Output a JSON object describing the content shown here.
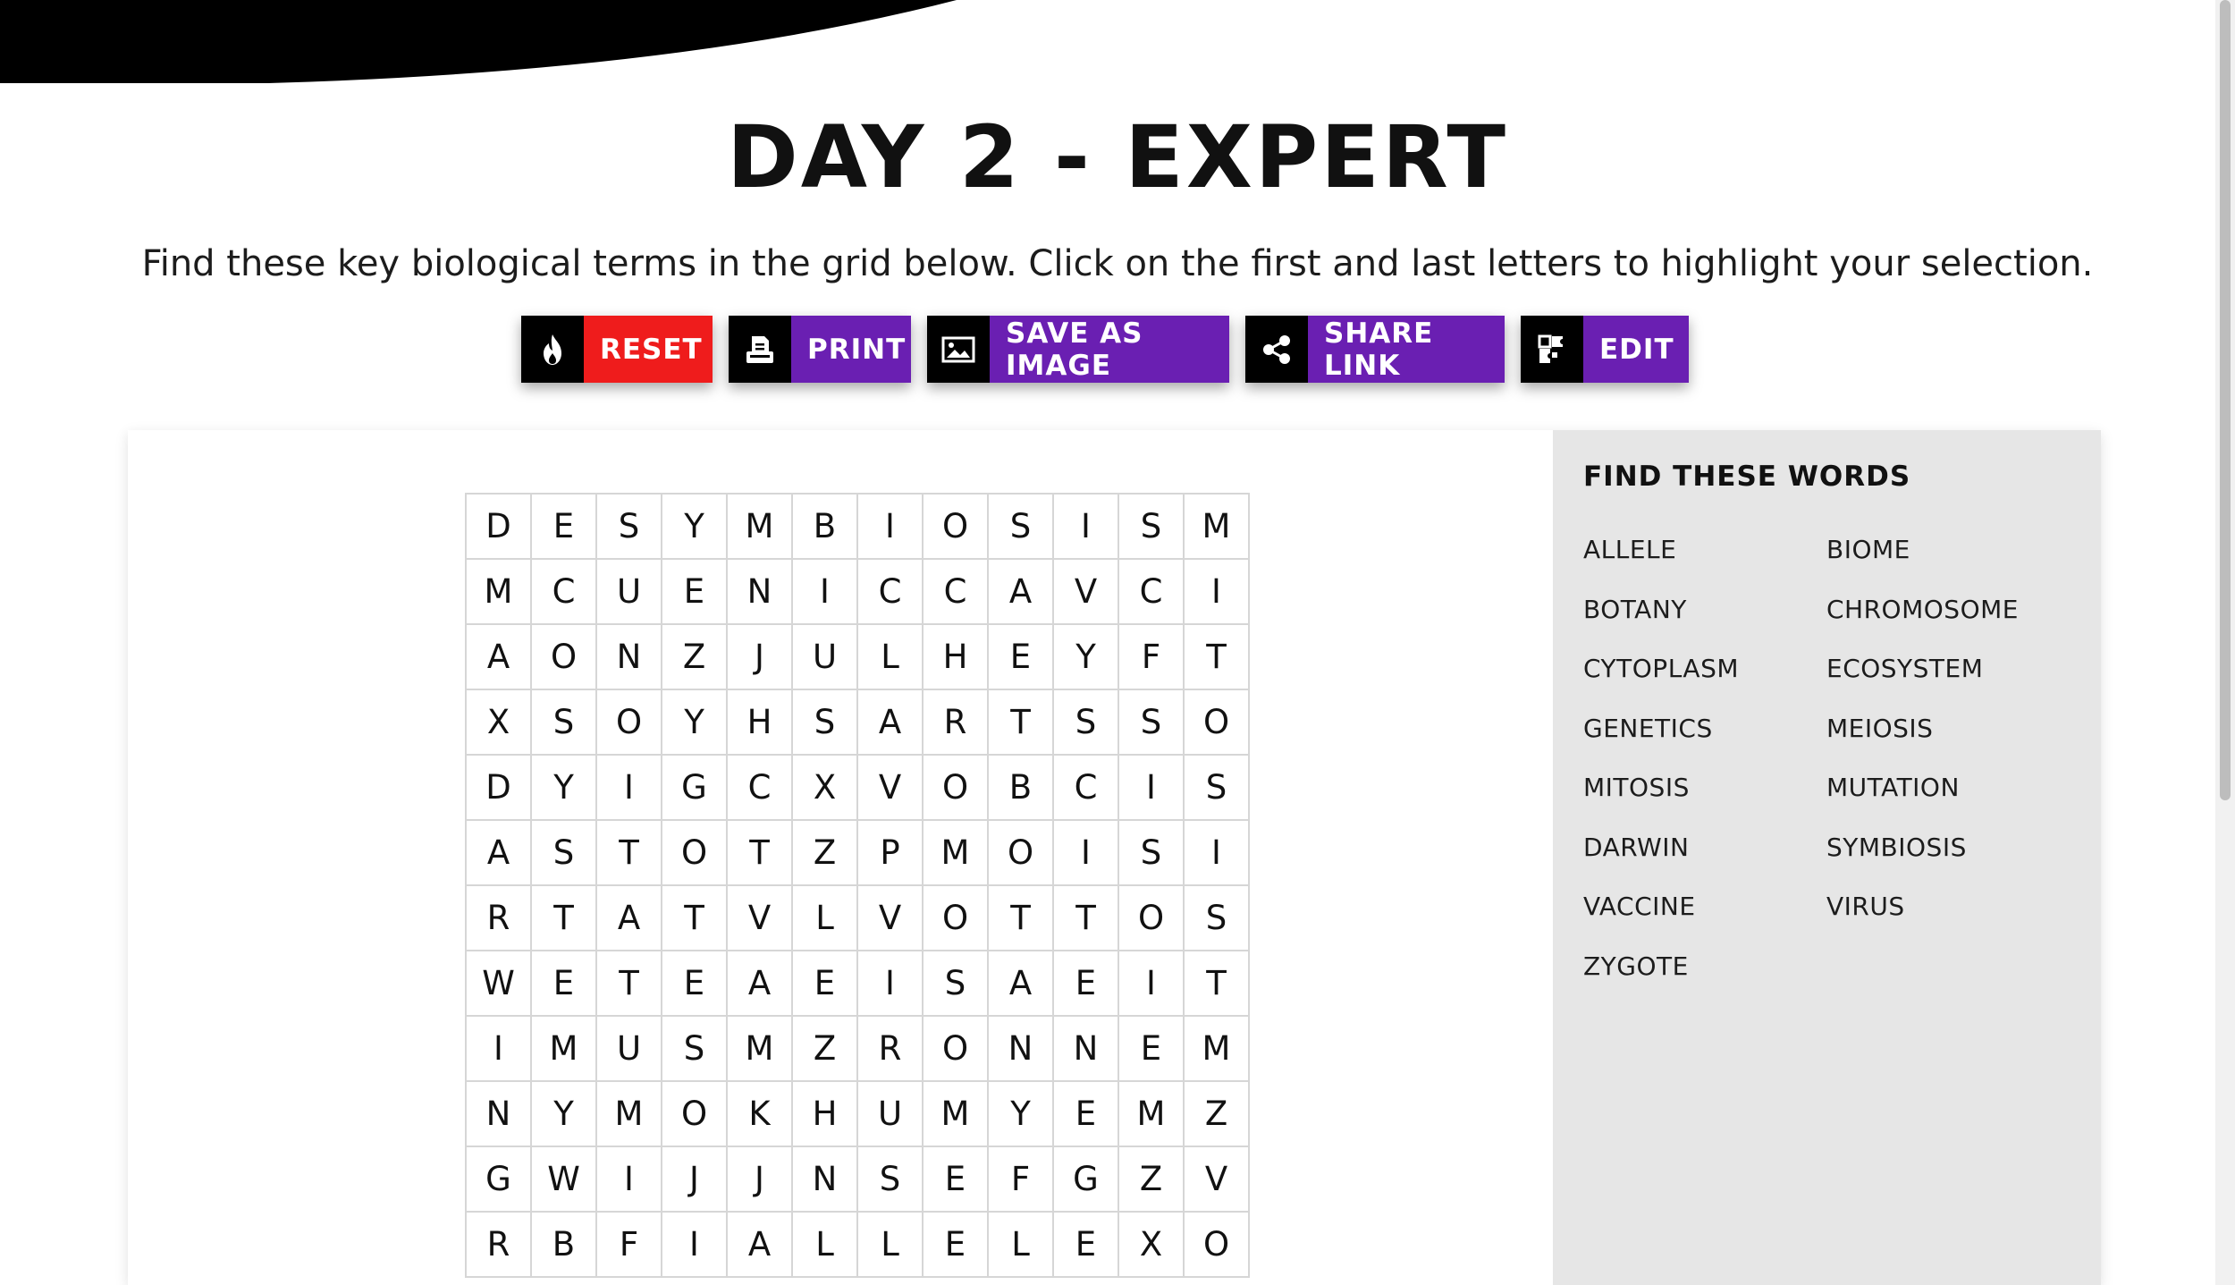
{
  "header": {
    "title": "DAY 2 - EXPERT",
    "instructions": "Find these key biological terms in the grid below. Click on the first and last letters to highlight your selection."
  },
  "toolbar": {
    "reset": {
      "label": "RESET",
      "icon": "fire-icon"
    },
    "print": {
      "label": "PRINT",
      "icon": "printer-icon"
    },
    "save_image": {
      "label": "SAVE AS IMAGE",
      "icon": "image-icon"
    },
    "share_link": {
      "label": "SHARE LINK",
      "icon": "share-icon"
    },
    "edit": {
      "label": "EDIT",
      "icon": "puzzle-icon"
    }
  },
  "colors": {
    "reset": "#ef1c1c",
    "purple": "#6a1fb2",
    "icon_bg": "#000000",
    "word_panel_bg": "#e6e6e6"
  },
  "grid": {
    "rows": [
      [
        "D",
        "E",
        "S",
        "Y",
        "M",
        "B",
        "I",
        "O",
        "S",
        "I",
        "S",
        "M"
      ],
      [
        "M",
        "C",
        "U",
        "E",
        "N",
        "I",
        "C",
        "C",
        "A",
        "V",
        "C",
        "I"
      ],
      [
        "A",
        "O",
        "N",
        "Z",
        "J",
        "U",
        "L",
        "H",
        "E",
        "Y",
        "F",
        "T"
      ],
      [
        "X",
        "S",
        "O",
        "Y",
        "H",
        "S",
        "A",
        "R",
        "T",
        "S",
        "S",
        "O"
      ],
      [
        "D",
        "Y",
        "I",
        "G",
        "C",
        "X",
        "V",
        "O",
        "B",
        "C",
        "I",
        "S"
      ],
      [
        "A",
        "S",
        "T",
        "O",
        "T",
        "Z",
        "P",
        "M",
        "O",
        "I",
        "S",
        "I"
      ],
      [
        "R",
        "T",
        "A",
        "T",
        "V",
        "L",
        "V",
        "O",
        "T",
        "T",
        "O",
        "S"
      ],
      [
        "W",
        "E",
        "T",
        "E",
        "A",
        "E",
        "I",
        "S",
        "A",
        "E",
        "I",
        "T"
      ],
      [
        "I",
        "M",
        "U",
        "S",
        "M",
        "Z",
        "R",
        "O",
        "N",
        "N",
        "E",
        "M"
      ],
      [
        "N",
        "Y",
        "M",
        "O",
        "K",
        "H",
        "U",
        "M",
        "Y",
        "E",
        "M",
        "Z"
      ],
      [
        "G",
        "W",
        "I",
        "J",
        "J",
        "N",
        "S",
        "E",
        "F",
        "G",
        "Z",
        "V"
      ],
      [
        "R",
        "B",
        "F",
        "I",
        "A",
        "L",
        "L",
        "E",
        "L",
        "E",
        "X",
        "O"
      ]
    ]
  },
  "word_panel": {
    "title": "FIND THESE WORDS",
    "words": [
      "ALLELE",
      "BIOME",
      "BOTANY",
      "CHROMOSOME",
      "CYTOPLASM",
      "ECOSYSTEM",
      "GENETICS",
      "MEIOSIS",
      "MITOSIS",
      "MUTATION",
      "DARWIN",
      "SYMBIOSIS",
      "VACCINE",
      "VIRUS",
      "ZYGOTE"
    ]
  }
}
